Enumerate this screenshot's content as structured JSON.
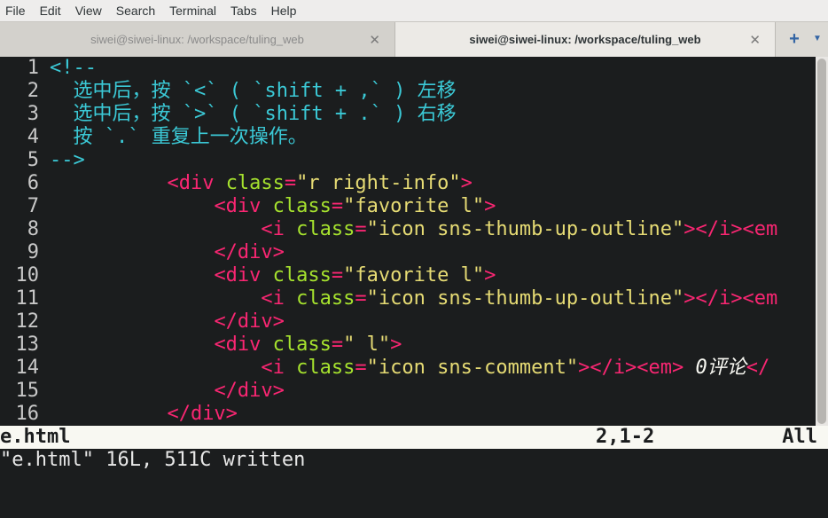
{
  "menubar": {
    "items": [
      "File",
      "Edit",
      "View",
      "Search",
      "Terminal",
      "Tabs",
      "Help"
    ]
  },
  "tabs": [
    {
      "title": "siwei@siwei-linux: /workspace/tuling_web",
      "active": false
    },
    {
      "title": "siwei@siwei-linux: /workspace/tuling_web",
      "active": true
    }
  ],
  "tab_close_glyph": "✕",
  "new_tab_glyph": "+",
  "tab_menu_glyph": "▼",
  "colors": {
    "editor_background": "#1b1d1e",
    "comment": "#3bc9d6",
    "tag": "#f92672",
    "attribute": "#a6e22e",
    "string": "#e6db74",
    "line_number": "#c8c8c8"
  },
  "editor": {
    "lines": [
      {
        "num": "1",
        "segments": [
          {
            "c": "comment",
            "t": "<!--"
          }
        ]
      },
      {
        "num": "2",
        "segments": [
          {
            "c": "comment",
            "t": "  选中后，按 `<` ( `shift + ,` ) 左移"
          }
        ]
      },
      {
        "num": "3",
        "segments": [
          {
            "c": "comment",
            "t": "  选中后，按 `>` ( `shift + .` ) 右移"
          }
        ]
      },
      {
        "num": "4",
        "segments": [
          {
            "c": "comment",
            "t": "  按 `.` 重复上一次操作。"
          }
        ]
      },
      {
        "num": "5",
        "segments": [
          {
            "c": "comment",
            "t": "-->"
          }
        ]
      },
      {
        "num": "6",
        "segments": [
          {
            "c": "plain",
            "t": "          "
          },
          {
            "c": "tag",
            "t": "<div"
          },
          {
            "c": "plain",
            "t": " "
          },
          {
            "c": "attr",
            "t": "class"
          },
          {
            "c": "tag",
            "t": "="
          },
          {
            "c": "str",
            "t": "\"r right-info\""
          },
          {
            "c": "tag",
            "t": ">"
          }
        ]
      },
      {
        "num": "7",
        "segments": [
          {
            "c": "plain",
            "t": "              "
          },
          {
            "c": "tag",
            "t": "<div"
          },
          {
            "c": "plain",
            "t": " "
          },
          {
            "c": "attr",
            "t": "class"
          },
          {
            "c": "tag",
            "t": "="
          },
          {
            "c": "str",
            "t": "\"favorite l\""
          },
          {
            "c": "tag",
            "t": ">"
          }
        ]
      },
      {
        "num": "8",
        "segments": [
          {
            "c": "plain",
            "t": "                  "
          },
          {
            "c": "tag",
            "t": "<i"
          },
          {
            "c": "plain",
            "t": " "
          },
          {
            "c": "attr",
            "t": "class"
          },
          {
            "c": "tag",
            "t": "="
          },
          {
            "c": "str",
            "t": "\"icon sns-thumb-up-outline\""
          },
          {
            "c": "tag",
            "t": "></i><em"
          }
        ]
      },
      {
        "num": "9",
        "segments": [
          {
            "c": "plain",
            "t": "              "
          },
          {
            "c": "tag",
            "t": "</div>"
          }
        ]
      },
      {
        "num": "10",
        "segments": [
          {
            "c": "plain",
            "t": "              "
          },
          {
            "c": "tag",
            "t": "<div"
          },
          {
            "c": "plain",
            "t": " "
          },
          {
            "c": "attr",
            "t": "class"
          },
          {
            "c": "tag",
            "t": "="
          },
          {
            "c": "str",
            "t": "\"favorite l\""
          },
          {
            "c": "tag",
            "t": ">"
          }
        ]
      },
      {
        "num": "11",
        "segments": [
          {
            "c": "plain",
            "t": "                  "
          },
          {
            "c": "tag",
            "t": "<i"
          },
          {
            "c": "plain",
            "t": " "
          },
          {
            "c": "attr",
            "t": "class"
          },
          {
            "c": "tag",
            "t": "="
          },
          {
            "c": "str",
            "t": "\"icon sns-thumb-up-outline\""
          },
          {
            "c": "tag",
            "t": "></i><em"
          }
        ]
      },
      {
        "num": "12",
        "segments": [
          {
            "c": "plain",
            "t": "              "
          },
          {
            "c": "tag",
            "t": "</div>"
          }
        ]
      },
      {
        "num": "13",
        "segments": [
          {
            "c": "plain",
            "t": "              "
          },
          {
            "c": "tag",
            "t": "<div"
          },
          {
            "c": "plain",
            "t": " "
          },
          {
            "c": "attr",
            "t": "class"
          },
          {
            "c": "tag",
            "t": "="
          },
          {
            "c": "str",
            "t": "\" l\""
          },
          {
            "c": "tag",
            "t": ">"
          }
        ]
      },
      {
        "num": "14",
        "segments": [
          {
            "c": "plain",
            "t": "                  "
          },
          {
            "c": "tag",
            "t": "<i"
          },
          {
            "c": "plain",
            "t": " "
          },
          {
            "c": "attr",
            "t": "class"
          },
          {
            "c": "tag",
            "t": "="
          },
          {
            "c": "str",
            "t": "\"icon sns-comment\""
          },
          {
            "c": "tag",
            "t": "></i><em>"
          },
          {
            "c": "italic",
            "t": " 0评论"
          },
          {
            "c": "tag",
            "t": "</"
          }
        ]
      },
      {
        "num": "15",
        "segments": [
          {
            "c": "plain",
            "t": "              "
          },
          {
            "c": "tag",
            "t": "</div>"
          }
        ]
      },
      {
        "num": "16",
        "segments": [
          {
            "c": "plain",
            "t": "          "
          },
          {
            "c": "tag",
            "t": "</div>"
          }
        ]
      }
    ]
  },
  "statusline": {
    "filename": "e.html",
    "position": "2,1-2",
    "percent": "All"
  },
  "cmdline": "\"e.html\" 16L, 511C written"
}
